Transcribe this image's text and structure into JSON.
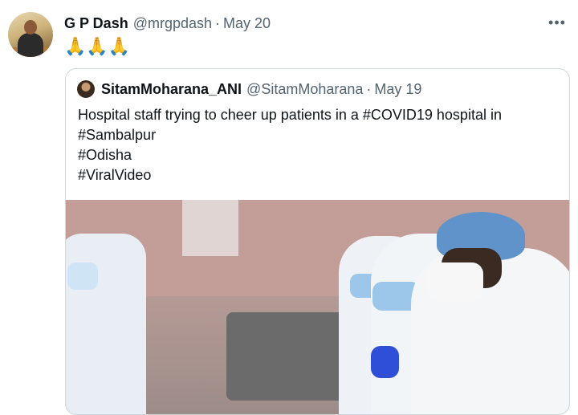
{
  "tweet": {
    "author_name": "G P Dash",
    "author_handle": "@mrgpdash",
    "separator": "·",
    "date": "May 20",
    "text": "🙏🙏🙏",
    "more_icon": "more-horizontal-icon"
  },
  "quoted_tweet": {
    "author_name": "SitamMoharana_ANI",
    "author_handle": "@SitamMoharana",
    "separator": "·",
    "date": "May 19",
    "lines": [
      "Hospital staff trying to cheer up patients in a #COVID19 hospital in",
      "#Sambalpur",
      "#Odisha",
      "#ViralVideo"
    ]
  },
  "media": {
    "type": "video-still",
    "colors": {
      "wall": "#c9a7a0",
      "ppe": "#e8eef3",
      "cap": "#5f93c9",
      "mask": "#9cc7ea",
      "glove": "#2f4fd8"
    }
  }
}
